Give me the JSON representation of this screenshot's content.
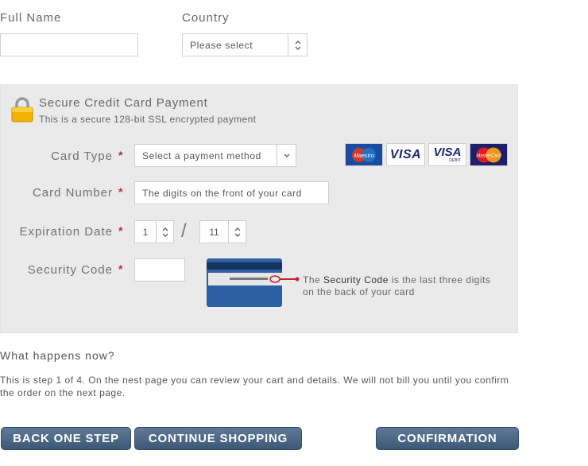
{
  "customer": {
    "full_name_label": "Full Name",
    "full_name_value": "",
    "country_label": "Country",
    "country_value": "Please select"
  },
  "payment": {
    "title": "Secure Credit Card Payment",
    "subtitle": "This is a secure 128-bit SSL encrypted payment",
    "required_mark": "*",
    "card_type": {
      "label": "Card Type",
      "value": "Select a payment method"
    },
    "card_logos": [
      {
        "name": "Maestro",
        "text": "Maestro"
      },
      {
        "name": "Visa",
        "text": "VISA"
      },
      {
        "name": "Visa Debit",
        "text": "VISA",
        "subtext": "DEBIT"
      },
      {
        "name": "MasterCard",
        "text": "MasterCard"
      }
    ],
    "card_number": {
      "label": "Card Number",
      "placeholder": "The digits on the front of your card"
    },
    "expiration": {
      "label": "Expiration Date",
      "month": "1",
      "year": "11",
      "separator": "/"
    },
    "security_code": {
      "label": "Security Code",
      "value": "",
      "note_prefix": "The ",
      "note_bold": "Security Code",
      "note_suffix": " is the last three digits on the back of your card"
    }
  },
  "info": {
    "title": "What happens now?",
    "body": "This is step 1 of 4. On the nest page you can review your cart and details. We will not bill you until you confirm the order on the next page."
  },
  "buttons": {
    "back": "BACK ONE STEP",
    "continue": "CONTINUE SHOPPING",
    "confirm": "CONFIRMATION"
  },
  "colors": {
    "required": "#c0282d",
    "button": "#4a6682",
    "panel": "#eaeaea"
  }
}
